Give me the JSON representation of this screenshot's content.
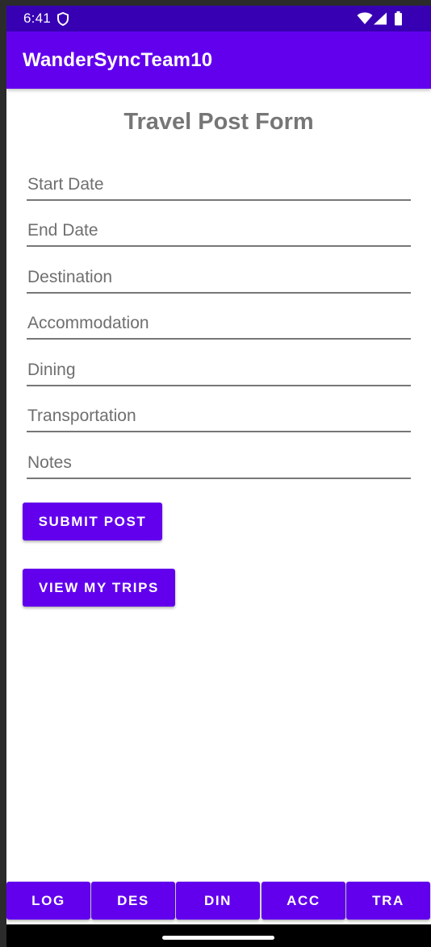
{
  "status_bar": {
    "time": "6:41",
    "icons": [
      "shield-icon",
      "wifi-icon",
      "signal-icon",
      "battery-icon"
    ]
  },
  "app_bar": {
    "title": "WanderSyncTeam10"
  },
  "form": {
    "title": "Travel Post Form",
    "fields": {
      "start_date": {
        "value": "",
        "placeholder": "Start Date"
      },
      "end_date": {
        "value": "",
        "placeholder": "End Date"
      },
      "destination": {
        "value": "",
        "placeholder": "Destination"
      },
      "accommodation": {
        "value": "",
        "placeholder": "Accommodation"
      },
      "dining": {
        "value": "",
        "placeholder": "Dining"
      },
      "transportation": {
        "value": "",
        "placeholder": "Transportation"
      },
      "notes": {
        "value": "",
        "placeholder": "Notes"
      }
    },
    "submit_label": "SUBMIT POST",
    "view_trips_label": "VIEW MY TRIPS"
  },
  "bottom_nav": {
    "items": [
      {
        "label": "LOG"
      },
      {
        "label": "DES"
      },
      {
        "label": "DIN"
      },
      {
        "label": "ACC"
      },
      {
        "label": "TRA"
      }
    ]
  },
  "colors": {
    "status_bar": "#3700b3",
    "primary": "#6200ee",
    "title_text": "#767676",
    "underline": "#777777"
  }
}
